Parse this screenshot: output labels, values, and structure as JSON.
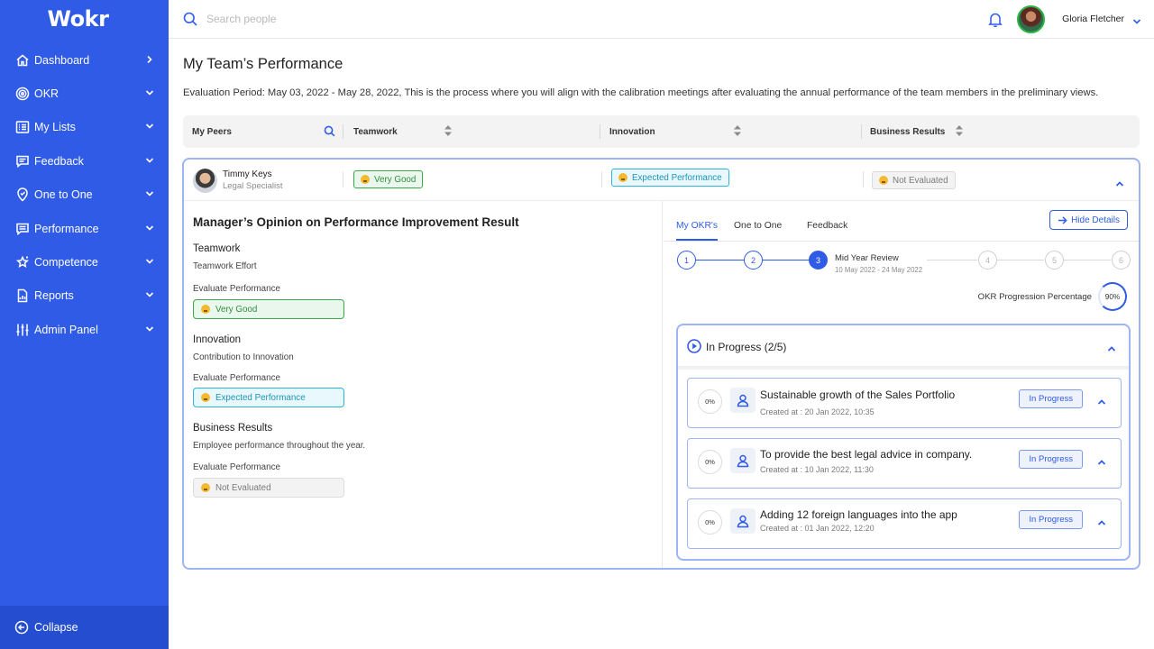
{
  "app": {
    "logo": "Wokr"
  },
  "sidebar": {
    "items": [
      {
        "label": "Dashboard",
        "icon": "home-icon",
        "chevron": "right"
      },
      {
        "label": "OKR",
        "icon": "target-icon",
        "chevron": "down"
      },
      {
        "label": "My Lists",
        "icon": "list-icon",
        "chevron": "down"
      },
      {
        "label": "Feedback",
        "icon": "chat-icon",
        "chevron": "down"
      },
      {
        "label": "One to One",
        "icon": "location-icon",
        "chevron": "down"
      },
      {
        "label": "Performance",
        "icon": "message-square-icon",
        "chevron": "down"
      },
      {
        "label": "Competence",
        "icon": "sparkle-star-icon",
        "chevron": "down"
      },
      {
        "label": "Reports",
        "icon": "report-icon",
        "chevron": "down"
      },
      {
        "label": "Admin Panel",
        "icon": "sliders-icon",
        "chevron": "down"
      }
    ],
    "collapse_label": "Collapse"
  },
  "topbar": {
    "search_placeholder": "Search people",
    "user_name": "Gloria Fletcher"
  },
  "page": {
    "title": "My Team’s Performance",
    "period": "Evaluation Period: May 03, 2022 - May 28, 2022, This is the process where you will align with the calibration meetings after evaluating the annual performance of the team members in the preliminary views."
  },
  "columns": {
    "peers": "My Peers",
    "teamwork": "Teamwork",
    "innovation": "Innovation",
    "business": "Business Results"
  },
  "row": {
    "name": "Timmy Keys",
    "role": "Legal Specialist",
    "teamwork": "Very Good",
    "innovation": "Expected Performance",
    "business": "Not Evaluated"
  },
  "opinion": {
    "title": "Manager’s Opinion on Performance Improvement Result",
    "sections": [
      {
        "heading": "Teamwork",
        "sub": "Teamwork Effort",
        "eval_label": "Evaluate Performance",
        "value": "Very Good"
      },
      {
        "heading": "Innovation",
        "sub": "Contribution to Innovation",
        "eval_label": "Evaluate Performance",
        "value": "Expected Performance"
      },
      {
        "heading": "Business Results",
        "sub": "Employee performance throughout the year.",
        "eval_label": "Evaluate Performance",
        "value": "Not Evaluated"
      }
    ]
  },
  "details": {
    "tabs": [
      "My OKR's",
      "One to One",
      "Feedback"
    ],
    "active_tab": "My OKR's",
    "hide_label": "Hide Details",
    "steps": [
      "1",
      "2",
      "3",
      "4",
      "5",
      "6"
    ],
    "current_step": 3,
    "step_title": "Mid Year Review",
    "step_date": "10 May 2022 - 24 May 2022",
    "progress_label": "OKR Progression Percentage",
    "progress_value": "90%",
    "progress_fraction": 0.9,
    "group_title": "In Progress (2/5)",
    "items": [
      {
        "pct": "0%",
        "title": "Sustainable growth of the Sales Portfolio",
        "created": "Created at : 20 Jan 2022, 10:35",
        "status": "In Progress"
      },
      {
        "pct": "0%",
        "title": "To provide the best legal advice in company.",
        "created": "Created at : 10 Jan 2022, 11:30",
        "status": "In Progress"
      },
      {
        "pct": "0%",
        "title": "Adding 12 foreign languages into the app",
        "created": "Created at : 01 Jan 2022, 12:20",
        "status": "In Progress"
      }
    ]
  },
  "colors": {
    "brand": "#2f5be6",
    "good": "#3aa74c",
    "expected": "#2db4d8",
    "neutral": "#dcdcdc"
  }
}
